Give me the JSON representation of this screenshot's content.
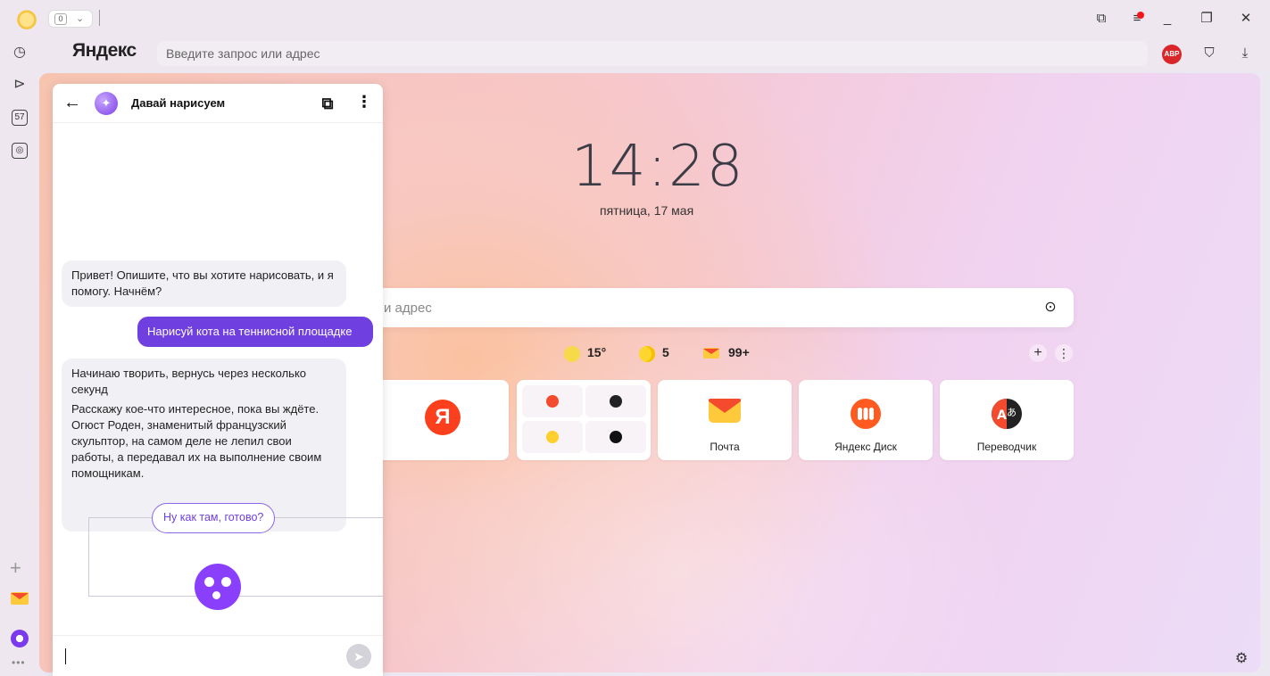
{
  "titlebar": {
    "tab_count": "0",
    "chevron": "⌄"
  },
  "sidebar": {
    "history_icon": "history-icon",
    "video_icon": "play-icon",
    "notes_count": "57",
    "screenshot_icon": "screenshot-icon",
    "plus": "+",
    "dots": "•••"
  },
  "browser": {
    "logo": "Яндекс",
    "address_placeholder": "Введите запрос или адрес",
    "abp_label": "ABP"
  },
  "newtab": {
    "time": "14:28",
    "date": "пятница, 17 мая",
    "search_placeholder": "и адрес",
    "weather": "15°",
    "moon_value": "5",
    "mail_count": "99+",
    "add_label": "+",
    "more_label": "⋮",
    "tiles": [
      {
        "label": "",
        "icon": "yandex-logo"
      },
      {
        "label": "",
        "icon": "widget-grid"
      },
      {
        "label": "Почта",
        "icon": "mail-icon"
      },
      {
        "label": "Яндекс Диск",
        "icon": "disk-icon"
      },
      {
        "label": "Переводчик",
        "icon": "translate-icon"
      }
    ],
    "yandex_letter": "Я"
  },
  "chat": {
    "title": "Давай нарисуем",
    "back": "←",
    "kebab": "⋮",
    "messages": [
      {
        "from": "bot",
        "text": "Привет! Опишите, что вы хотите нарисовать, и я помогу. Начнём?"
      },
      {
        "from": "user",
        "text": "Нарисуй кота на теннисной площадке"
      },
      {
        "from": "bot",
        "text": "Начинаю творить, вернусь через несколько секунд"
      },
      {
        "from": "bot",
        "text": "Расскажу кое-что интересное, пока вы ждёте. Огюст Роден, знаменитый французский скульптор, на самом деле не лепил свои работы, а передавал их на выполнение своим помощникам."
      }
    ],
    "suggestion": "Ну как там, готово?",
    "input_value": ""
  },
  "colors": {
    "accent": "#6f3fe0",
    "yandex_red": "#fc3f1d",
    "alice_purple": "#8a3ffc"
  }
}
